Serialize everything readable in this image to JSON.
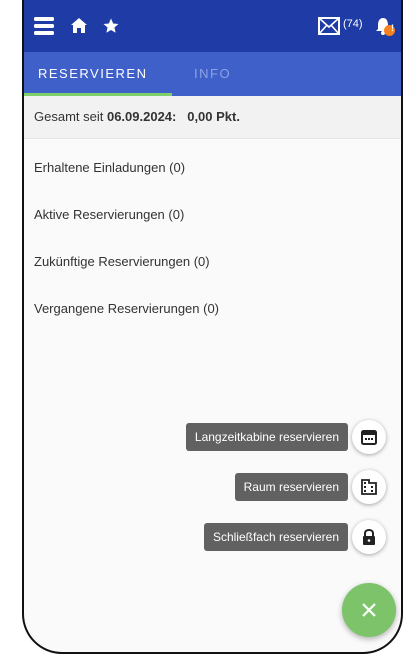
{
  "header": {
    "icons": [
      "menu-icon",
      "home-icon",
      "star-icon",
      "mail-icon",
      "bell-icon"
    ],
    "mail_count": "(74)",
    "notification_badge": "!",
    "accent_color": "#1f3ca6"
  },
  "tabs": [
    {
      "label": "Reservieren",
      "active": true
    },
    {
      "label": "Info",
      "active": false
    }
  ],
  "summary": {
    "prefix": "Gesamt seit ",
    "date": "06.09.2024:",
    "points": "0,00 Pkt."
  },
  "reservations": [
    {
      "label": "Erhaltene Einladungen (0)"
    },
    {
      "label": "Aktive Reservierungen (0)"
    },
    {
      "label": "Zukünftige Reservierungen (0)"
    },
    {
      "label": "Vergangene Reservierungen (0)"
    }
  ],
  "speed_dial": {
    "actions": [
      {
        "label": "Langzeitkabine reservieren",
        "icon": "calendar-icon"
      },
      {
        "label": "Raum reservieren",
        "icon": "building-icon"
      },
      {
        "label": "Schließfach reservieren",
        "icon": "lock-icon"
      }
    ],
    "fab_icon": "close-icon",
    "fab_color": "#7cc36a"
  }
}
